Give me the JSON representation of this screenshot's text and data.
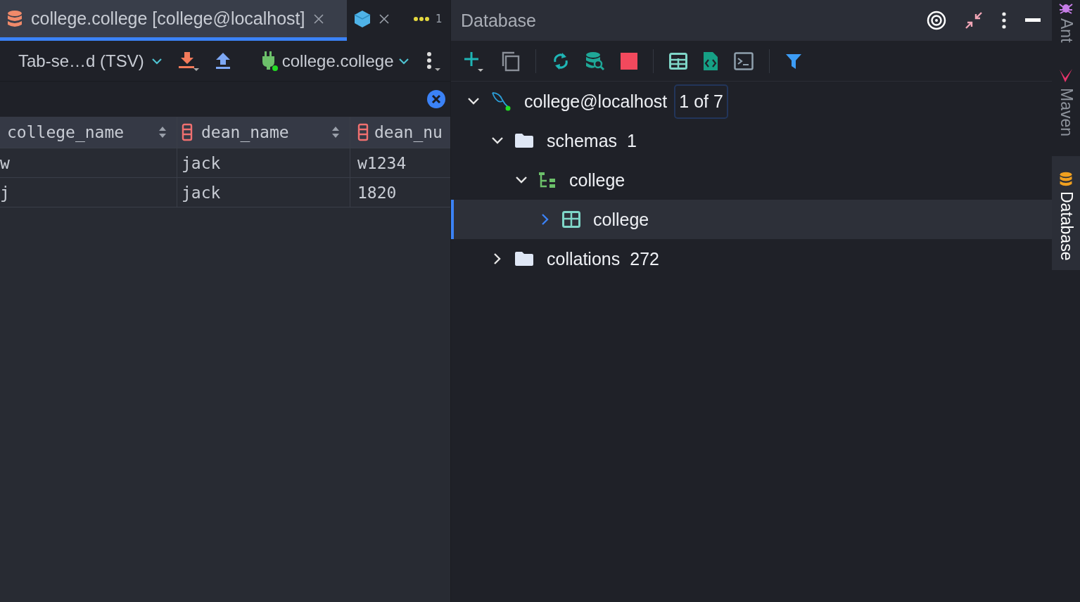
{
  "editor_tabs": [
    {
      "kind": "database",
      "label": "college.college [college@localhost]",
      "selected": true
    },
    {
      "kind": "cube",
      "selected": false
    }
  ],
  "tab_overflow": {
    "count": "1"
  },
  "data_toolbar": {
    "format": "Tab-se…d (TSV)",
    "session": "college.college"
  },
  "grid": {
    "columns": [
      {
        "name": "college_name",
        "kind": "plain"
      },
      {
        "name": "dean_name",
        "kind": "column"
      },
      {
        "name": "dean_nu",
        "kind": "column"
      }
    ],
    "rows": [
      [
        "w",
        "jack",
        "w1234"
      ],
      [
        "j",
        "jack",
        "1820"
      ]
    ]
  },
  "tool_window": {
    "title": "Database",
    "tree": [
      {
        "label": "college@localhost",
        "kind": "datasource",
        "expanded": true,
        "selected": false,
        "badge": "1 of 7",
        "children": [
          {
            "label": "schemas",
            "count": "1",
            "kind": "folder",
            "expanded": true,
            "selected": false,
            "children": [
              {
                "label": "college",
                "kind": "schema",
                "expanded": true,
                "selected": false,
                "children": [
                  {
                    "label": "college",
                    "kind": "table",
                    "expanded": false,
                    "selected": true
                  }
                ]
              }
            ]
          },
          {
            "label": "collations",
            "count": "272",
            "kind": "folder",
            "expanded": false,
            "selected": false
          }
        ]
      }
    ]
  },
  "side_strip": [
    {
      "label": "Ant",
      "kind": "ant",
      "selected": false
    },
    {
      "label": "Maven",
      "kind": "maven",
      "selected": false
    },
    {
      "label": "Database",
      "kind": "database",
      "selected": true
    }
  ]
}
